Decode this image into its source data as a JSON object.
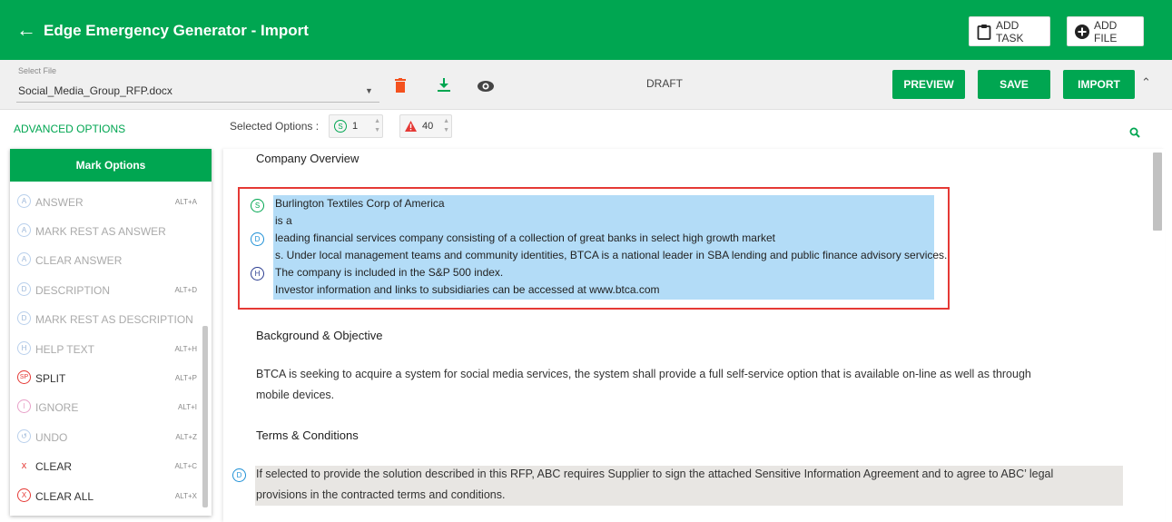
{
  "header": {
    "title": "Edge Emergency Generator - Import",
    "add_task_label": "ADD TASK",
    "add_file_label": "ADD FILE",
    "bg_color": "#00a651"
  },
  "toolbar": {
    "select_file_label": "Select File",
    "select_file_value": "Social_Media_Group_RFP.docx",
    "status": "DRAFT",
    "preview_label": "PREVIEW",
    "save_label": "SAVE",
    "import_label": "IMPORT",
    "delete_icon": "trash-icon",
    "download_icon": "download-icon",
    "view_icon": "eye-icon",
    "delete_color": "#f4511e",
    "download_color": "#00a651"
  },
  "options": {
    "advanced_label": "ADVANCED OPTIONS",
    "selected_label": "Selected Options :",
    "selected_s_badge": "S",
    "selected_s_count": "1",
    "selected_warning_count": "40"
  },
  "mark_panel": {
    "title": "Mark Options",
    "items": [
      {
        "badge": "A",
        "label": "ANSWER",
        "shortcut": "ALT+A"
      },
      {
        "badge": "A",
        "label": "MARK REST AS ANSWER",
        "shortcut": ""
      },
      {
        "badge": "A",
        "label": "CLEAR ANSWER",
        "shortcut": ""
      },
      {
        "badge": "D",
        "label": "DESCRIPTION",
        "shortcut": "ALT+D"
      },
      {
        "badge": "D",
        "label": "MARK REST AS DESCRIPTION",
        "shortcut": ""
      },
      {
        "badge": "H",
        "label": "HELP TEXT",
        "shortcut": "ALT+H"
      },
      {
        "badge": "SP",
        "label": "SPLIT",
        "shortcut": "ALT+P"
      },
      {
        "badge": "I",
        "label": "IGNORE",
        "shortcut": "ALT+I"
      },
      {
        "badge": "↺",
        "label": "UNDO",
        "shortcut": "ALT+Z"
      },
      {
        "badge": "x",
        "label": "CLEAR",
        "shortcut": "ALT+C"
      },
      {
        "badge": "X",
        "label": "CLEAR ALL",
        "shortcut": "ALT+X"
      }
    ]
  },
  "document": {
    "section1_title": "Company Overview",
    "highlight_lines": [
      "Burlington Textiles Corp of America",
      "is a",
      "leading financial services company consisting of a collection of great banks in select high growth market",
      "s. Under local management teams and community identities, BTCA is a national leader in SBA lending and public finance advisory services.",
      "The company is included in the S&P 500 index.",
      "Investor information and links to subsidiaries can be accessed at www.btca.com"
    ],
    "tag_s": "S",
    "tag_d": "D",
    "tag_h": "H",
    "section2_title": "Background & Objective",
    "section2_body_1": "BTCA is seeking to acquire a system for social media services, the system shall provide a full self-service option that is available on-line as well as through",
    "section2_body_2": "mobile devices.",
    "section3_title": "Terms & Conditions",
    "section3_tag": "D",
    "section3_body_1": "If selected to provide the solution described in this RFP, ABC requires Supplier to sign the attached Sensitive Information Agreement and to agree to ABC’ legal",
    "section3_body_2": "provisions in the contracted terms and conditions."
  }
}
